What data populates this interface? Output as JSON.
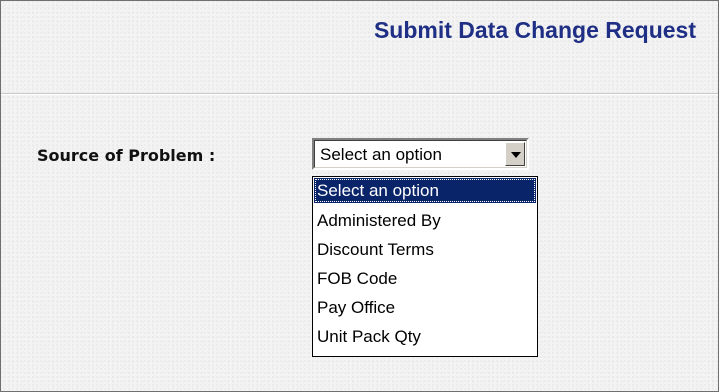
{
  "header": {
    "title": "Submit Data Change Request"
  },
  "form": {
    "source_label": "Source of Problem :",
    "select": {
      "value": "Select an option",
      "expanded": true,
      "options": [
        "Select an option",
        "Administered By",
        "Discount Terms",
        "FOB Code",
        "Pay Office",
        "Unit Pack Qty"
      ],
      "highlighted_index": 0
    }
  },
  "colors": {
    "title": "#1f2f85",
    "highlight": "#0a246a",
    "background": "#f3f3f3"
  },
  "icons": {
    "dropdown": "chevron-down-icon"
  }
}
